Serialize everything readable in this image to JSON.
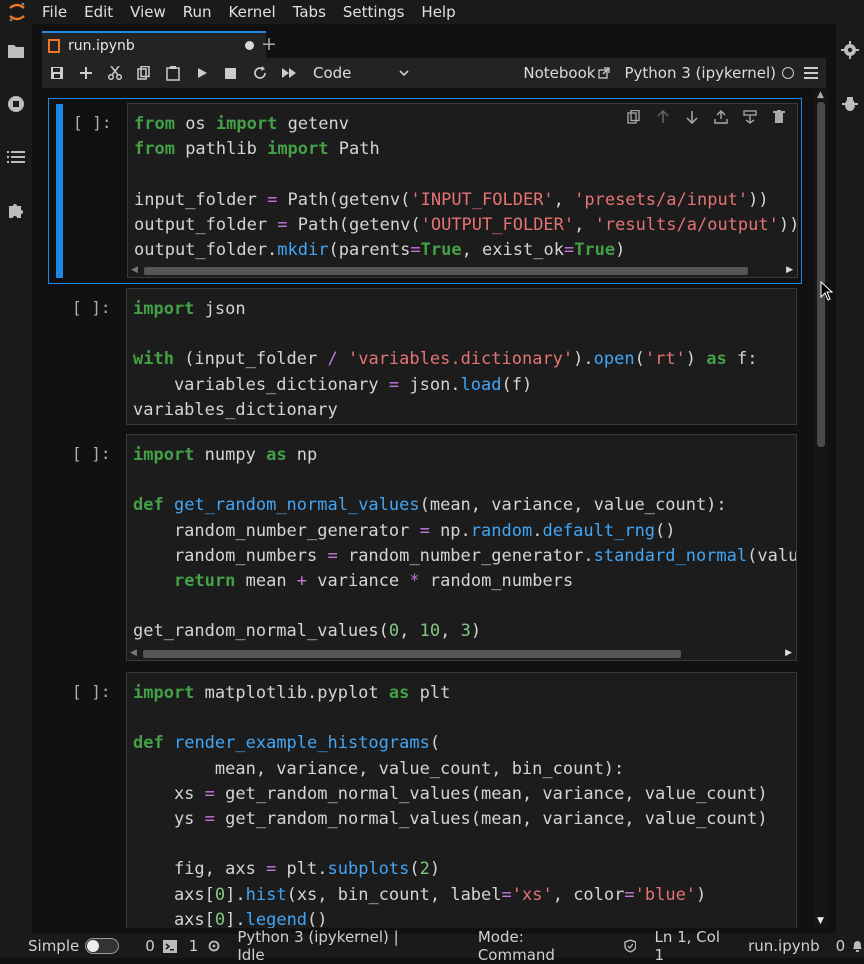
{
  "menu": [
    "File",
    "Edit",
    "View",
    "Run",
    "Kernel",
    "Tabs",
    "Settings",
    "Help"
  ],
  "tab": {
    "label": "run.ipynb",
    "add_label": "+"
  },
  "toolbar": {
    "cell_type": "Code",
    "notebook_label": "Notebook",
    "kernel_label": "Python 3 (ipykernel)"
  },
  "cells": [
    {
      "prompt": "[ ]:"
    },
    {
      "prompt": "[ ]:"
    },
    {
      "prompt": "[ ]:"
    },
    {
      "prompt": "[ ]:"
    }
  ],
  "status": {
    "mode_label": "Simple",
    "terminals_count": "0",
    "kernels_count": "1",
    "kernel_status": "Python 3 (ipykernel) | Idle",
    "mode": "Mode: Command",
    "position": "Ln 1, Col 1",
    "filename": "run.ipynb",
    "notifications": "0"
  },
  "colors": {
    "accent": "#1e88e5",
    "keyword": "#43a047",
    "string": "#e57373",
    "function": "#42a5f5",
    "operator": "#c677dd"
  }
}
